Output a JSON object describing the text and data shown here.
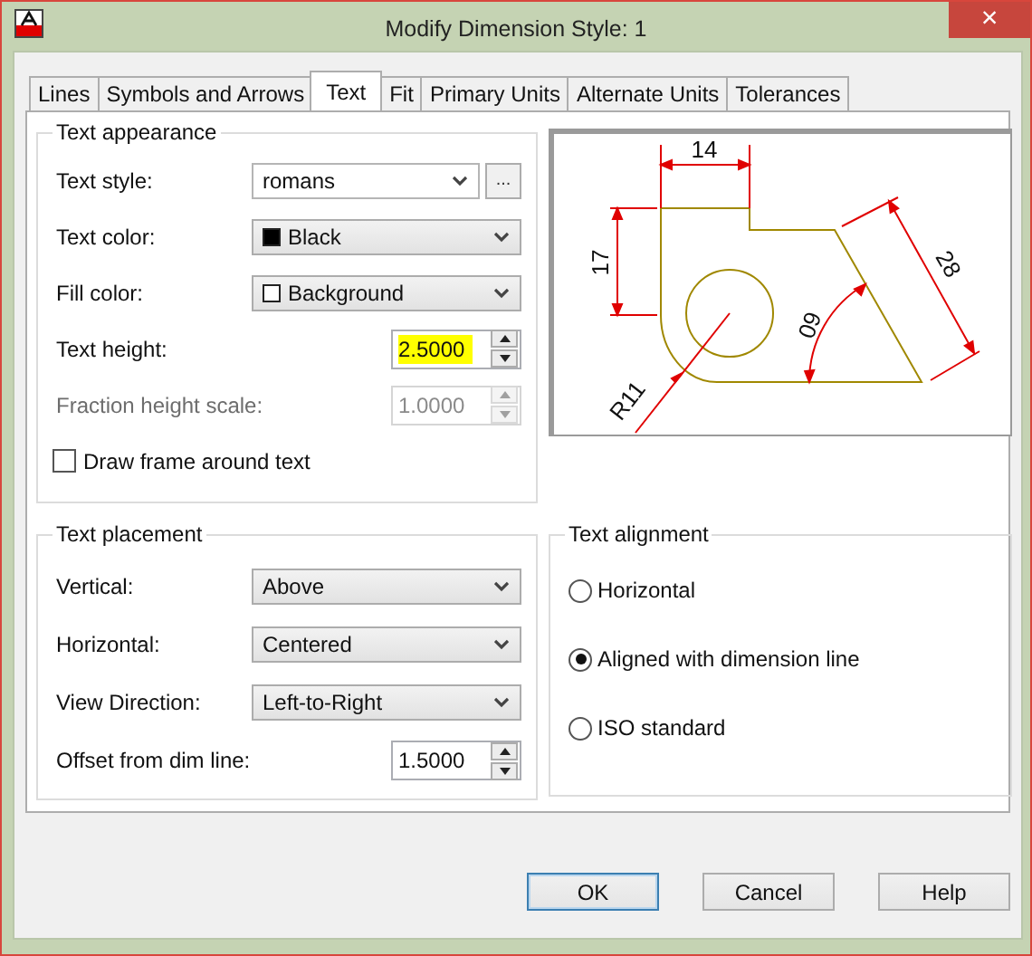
{
  "window": {
    "title": "Modify Dimension Style: 1",
    "close": "×"
  },
  "tabs": [
    {
      "label": "Lines",
      "selected": false
    },
    {
      "label": "Symbols and Arrows",
      "selected": false
    },
    {
      "label": "Text",
      "selected": true
    },
    {
      "label": "Fit",
      "selected": false
    },
    {
      "label": "Primary Units",
      "selected": false
    },
    {
      "label": "Alternate Units",
      "selected": false
    },
    {
      "label": "Tolerances",
      "selected": false
    }
  ],
  "text_appearance": {
    "title": "Text appearance",
    "rows": [
      {
        "kind": "combo",
        "label": "Text style:",
        "value": "romans",
        "button": "..."
      },
      {
        "kind": "color",
        "label": "Text color:",
        "value": "Black",
        "color": "#000000"
      },
      {
        "kind": "color",
        "label": "Fill color:",
        "value": "Background",
        "color": "#ffffff"
      },
      {
        "kind": "spinner",
        "label": "Text height:",
        "value": "2.5000",
        "highlighted": true,
        "disabled": false
      },
      {
        "kind": "spinner",
        "label": "Fraction height scale:",
        "value": "1.0000",
        "highlighted": false,
        "disabled": true
      },
      {
        "kind": "checkbox",
        "label": "Draw frame around text",
        "checked": false
      }
    ]
  },
  "preview": {
    "labels": [
      "14",
      "17",
      "28",
      "60",
      "R11"
    ]
  },
  "text_placement": {
    "title": "Text placement",
    "rows": [
      {
        "kind": "dropdown",
        "label": "Vertical:",
        "value": "Above"
      },
      {
        "kind": "dropdown",
        "label": "Horizontal:",
        "value": "Centered"
      },
      {
        "kind": "dropdown",
        "label": "View Direction:",
        "value": "Left-to-Right"
      },
      {
        "kind": "spinner",
        "label": "Offset from dim line:",
        "value": "1.5000",
        "highlighted": false,
        "disabled": false
      }
    ]
  },
  "text_alignment": {
    "title": "Text alignment",
    "options": [
      {
        "label": "Horizontal",
        "selected": false
      },
      {
        "label": "Aligned with dimension line",
        "selected": true
      },
      {
        "label": "ISO standard",
        "selected": false
      }
    ]
  },
  "buttons": [
    {
      "label": "OK",
      "default": true
    },
    {
      "label": "Cancel",
      "default": false
    },
    {
      "label": "Help",
      "default": false
    }
  ]
}
